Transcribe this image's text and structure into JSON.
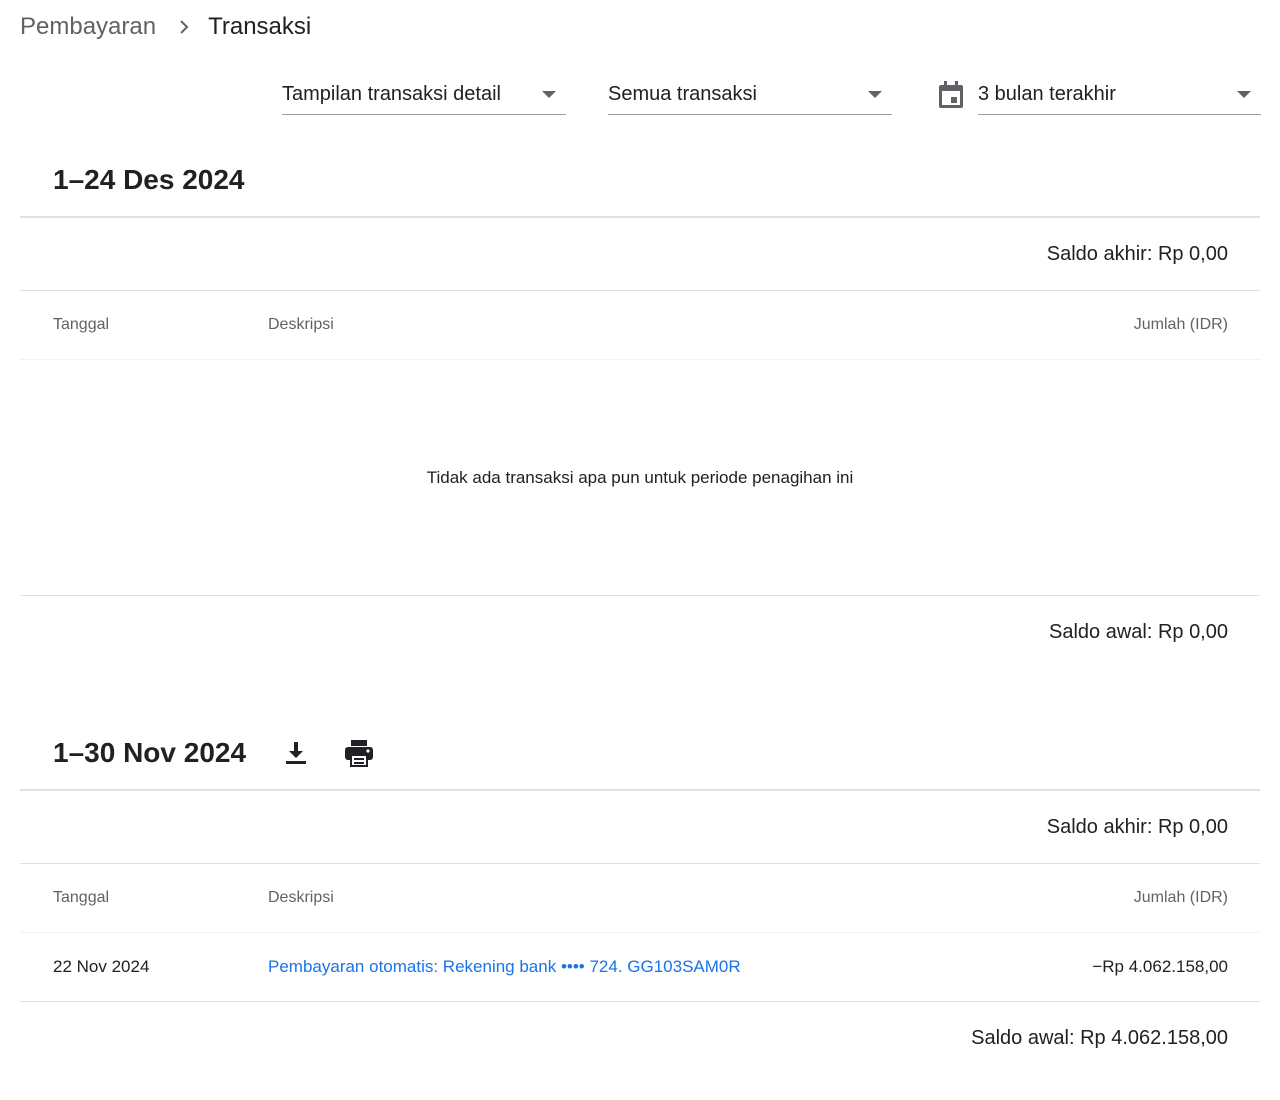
{
  "breadcrumb": {
    "parent": "Pembayaran",
    "current": "Transaksi"
  },
  "filters": {
    "view": "Tampilan transaksi detail",
    "type": "Semua transaksi",
    "range": "3 bulan terakhir"
  },
  "periods": [
    {
      "title": "1–24 Des 2024",
      "closing_balance": "Saldo akhir: Rp 0,00",
      "columns": {
        "date": "Tanggal",
        "description": "Deskripsi",
        "amount": "Jumlah (IDR)"
      },
      "empty_message": "Tidak ada transaksi apa pun untuk periode penagihan ini",
      "opening_balance": "Saldo awal: Rp 0,00"
    },
    {
      "title": "1–30 Nov 2024",
      "closing_balance": "Saldo akhir: Rp 0,00",
      "columns": {
        "date": "Tanggal",
        "description": "Deskripsi",
        "amount": "Jumlah (IDR)"
      },
      "transactions": [
        {
          "date": "22 Nov 2024",
          "description": "Pembayaran otomatis: Rekening bank •••• 724. GG103SAM0R",
          "amount": "−Rp 4.062.158,00"
        }
      ],
      "opening_balance": "Saldo awal: Rp 4.062.158,00"
    }
  ],
  "icons": {
    "breadcrumb_separator": "chevron-right-icon",
    "dropdown": "arrow-drop-down-icon",
    "date_range": "calendar-icon",
    "download": "download-icon",
    "print": "print-icon"
  },
  "colors": {
    "link": "#1a73e8",
    "muted": "#5f6368",
    "text": "#202124",
    "divider": "#e0e0e0"
  }
}
